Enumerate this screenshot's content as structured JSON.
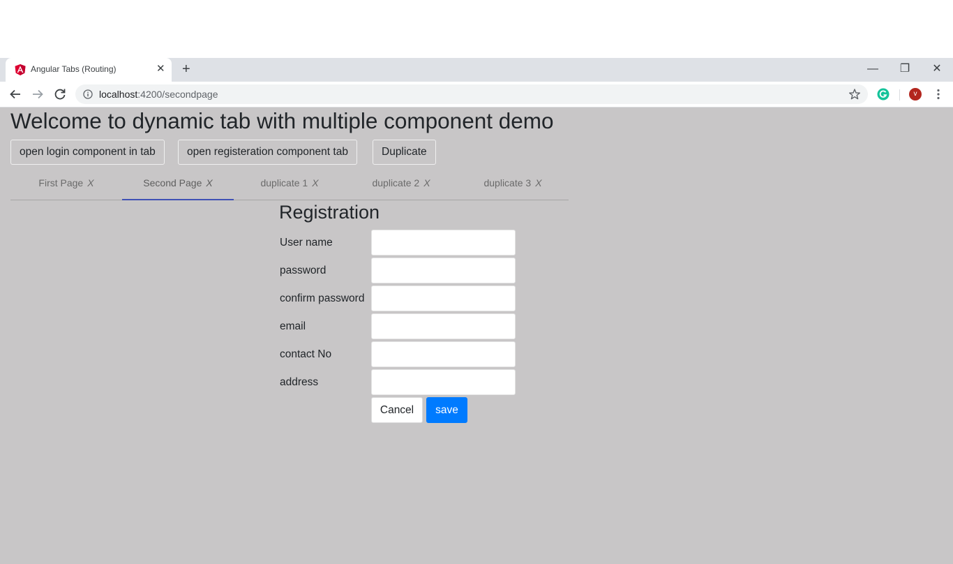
{
  "browser": {
    "tab": {
      "title": "Angular Tabs (Routing)",
      "favicon": "angular-icon",
      "close": "✕"
    },
    "new_tab": "+",
    "window_controls": {
      "minimize": "—",
      "restore": "❐",
      "close": "✕"
    },
    "address": {
      "host": "localhost",
      "path": ":4200/secondpage"
    },
    "avatar_letter": "v"
  },
  "page": {
    "heading": "Welcome to dynamic tab with multiple component demo",
    "buttons": [
      {
        "label": "open login component in tab"
      },
      {
        "label": "open registeration component tab"
      },
      {
        "label": "Duplicate"
      }
    ],
    "tabs": [
      {
        "label": "First Page",
        "close": "X",
        "active": false
      },
      {
        "label": "Second Page",
        "close": "X",
        "active": true
      },
      {
        "label": "duplicate 1",
        "close": "X",
        "active": false
      },
      {
        "label": "duplicate 2",
        "close": "X",
        "active": false
      },
      {
        "label": "duplicate 3",
        "close": "X",
        "active": false
      }
    ]
  },
  "form": {
    "title": "Registration",
    "fields": [
      {
        "label": "User name",
        "value": ""
      },
      {
        "label": "password",
        "value": ""
      },
      {
        "label": "confirm password",
        "value": ""
      },
      {
        "label": "email",
        "value": ""
      },
      {
        "label": "contact No",
        "value": ""
      },
      {
        "label": "address",
        "value": ""
      }
    ],
    "cancel_label": "Cancel",
    "save_label": "save"
  },
  "colors": {
    "page_background": "#c8c6c7",
    "active_tab_indicator": "#3f51b5",
    "save_button": "#007bff",
    "avatar": "#b3261e"
  }
}
